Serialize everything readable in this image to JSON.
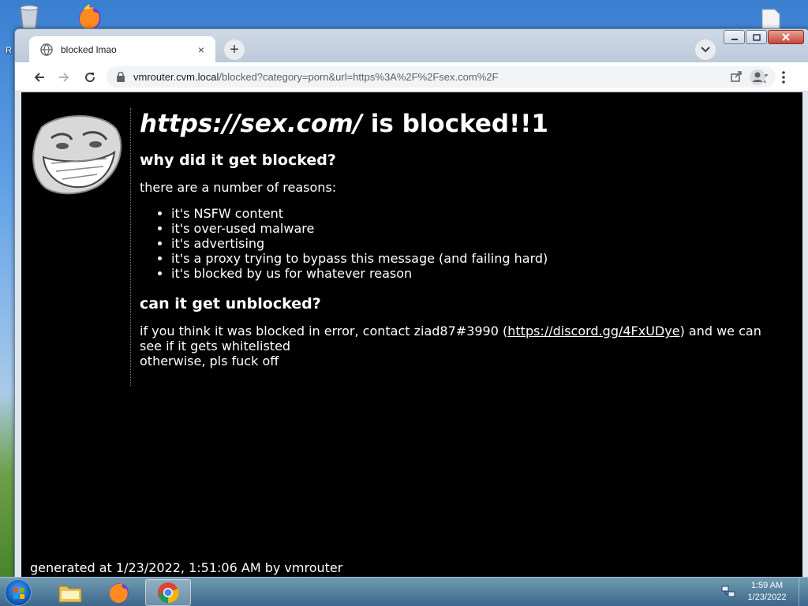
{
  "desktop": {
    "side_letter": "R",
    "icons": [
      "recycle-bin-icon",
      "firefox-icon",
      "document-icon"
    ]
  },
  "browser": {
    "tab": {
      "title": "blocked lmao",
      "close": "×"
    },
    "new_tab": "+",
    "address": {
      "host": "vmrouter.cvm.local",
      "path": "/blocked?category=porn&url=https%3A%2F%2Fsex.com%2F"
    }
  },
  "page": {
    "heading_url": "https://sex.com/",
    "heading_suffix": " is blocked!!1",
    "why_heading": "why did it get blocked?",
    "reasons_intro": "there are a number of reasons:",
    "reasons": [
      "it's NSFW content",
      "it's over-used malware",
      "it's advertising",
      "it's a proxy trying to bypass this message (and failing hard)",
      "it's blocked by us for whatever reason"
    ],
    "unblock_heading": "can it get unblocked?",
    "contact_prefix": "if you think it was blocked in error, contact ziad87#3990 (",
    "contact_link": "https://discord.gg/4FxUDye",
    "contact_suffix": ") and we can see if it gets whitelisted",
    "contact_line2": "otherwise, pls fuck off",
    "footer": "generated at 1/23/2022, 1:51:06 AM by vmrouter"
  },
  "taskbar": {
    "apps": [
      "explorer",
      "firefox",
      "chrome"
    ],
    "active_app": "chrome",
    "time": "1:59 AM",
    "date": "1/23/2022"
  }
}
